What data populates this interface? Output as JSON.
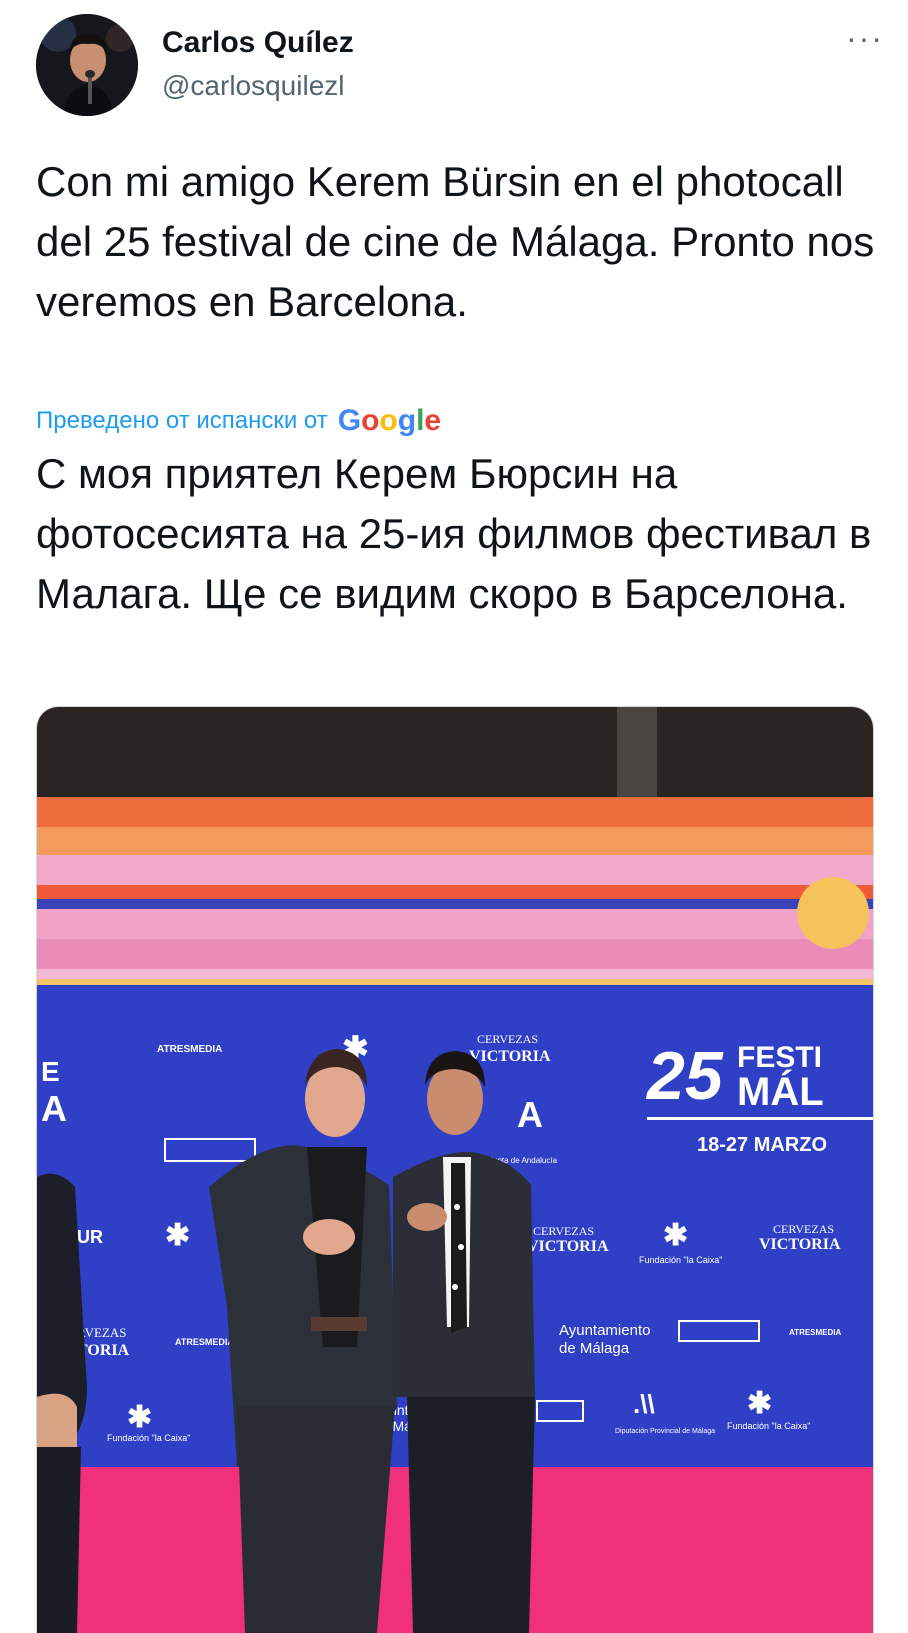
{
  "author": {
    "display_name": "Carlos Quílez",
    "handle": "@carlosquilezl"
  },
  "more_menu_label": "···",
  "tweet": {
    "text": "Con mi amigo Kerem Bürsin en el photocall del 25 festival de cine de Málaga. Pronto nos veremos en Barcelona.",
    "translated_label": "Преведено от испански от",
    "translation_provider": "Google",
    "translation": "С моя приятел Керем Бюрсин на фотосесията на 25-ия филмов фестивал в Малага. Ще се видим скоро в Барселона."
  },
  "photo": {
    "backdrop_text": {
      "festival_number": "25",
      "festival_word": "FESTI",
      "festival_city": "MÁL",
      "festival_dates": "18-27 MARZO",
      "sponsor_atresmedia": "ATRESMEDIA",
      "sponsor_cervezas": "CERVEZAS",
      "sponsor_victoria": "VICTORIA",
      "sponsor_fundacion": "Fundación \"la Caixa\"",
      "sponsor_ayuntamiento": "Ayuntamiento",
      "sponsor_de_malaga": "de Málaga",
      "sponsor_junta": "Junta de Andalucía",
      "sponsor_diputacion": "Diputación Provincial de Málaga",
      "partial_e": "E",
      "partial_a": "A",
      "partial_ur": "UR",
      "partial_rvezas": "RVEZAS",
      "partial_toria": "TORIA",
      "partial_ayunt": "Ayunt",
      "partial_dema": "de Má"
    },
    "colors": {
      "backdrop_blue": "#2f3fc6",
      "carpet_pink": "#f0307a",
      "stripe_orange": "#f07a4a",
      "stripe_pink": "#f0a6c6"
    }
  }
}
